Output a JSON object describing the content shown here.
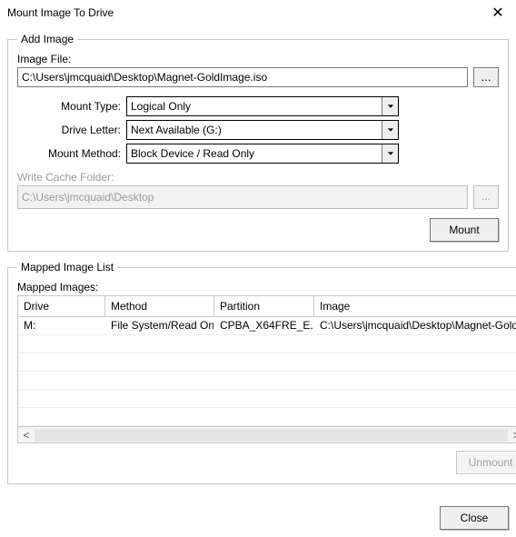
{
  "window": {
    "title": "Mount Image To Drive"
  },
  "add_image": {
    "legend": "Add Image",
    "image_file_label": "Image File:",
    "image_file_value": "C:\\Users\\jmcquaid\\Desktop\\Magnet-GoldImage.iso",
    "browse_label": "...",
    "mount_type_label": "Mount Type:",
    "mount_type_value": "Logical Only",
    "drive_letter_label": "Drive Letter:",
    "drive_letter_value": "Next Available (G:)",
    "mount_method_label": "Mount Method:",
    "mount_method_value": "Block Device / Read Only",
    "write_cache_label": "Write Cache Folder:",
    "write_cache_value": "C:\\Users\\jmcquaid\\Desktop",
    "cache_browse_label": "...",
    "mount_button": "Mount"
  },
  "mapped": {
    "legend": "Mapped Image List",
    "list_label": "Mapped Images:",
    "columns": {
      "drive": "Drive",
      "method": "Method",
      "partition": "Partition",
      "image": "Image"
    },
    "rows": [
      {
        "drive": "M:",
        "method": "File System/Read Only",
        "partition": "CPBA_X64FRE_E...",
        "image": "C:\\Users\\jmcquaid\\Desktop\\Magnet-Gold"
      }
    ],
    "unmount_button": "Unmount"
  },
  "footer": {
    "close_button": "Close"
  }
}
